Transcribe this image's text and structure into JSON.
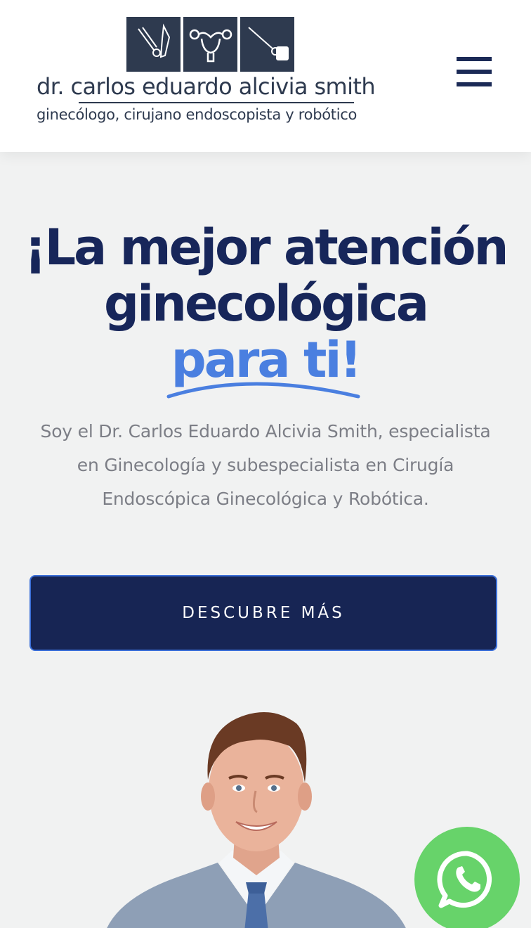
{
  "header": {
    "logo_name": "dr. carlos eduardo alcivia smith",
    "logo_subtitle": "ginecólogo, cirujano endoscopista y robótico",
    "menu_icon": "hamburger-menu-icon"
  },
  "hero": {
    "title_line1": "¡La mejor atención",
    "title_line2": "ginecológica",
    "title_accent": "para ti!",
    "description": "Soy el Dr. Carlos Eduardo Alcivia Smith, especialista en Ginecología y subespecialista en Cirugía Endoscópica Ginecológica y Robótica.",
    "cta_label": "DESCUBRE MÁS"
  },
  "floating": {
    "whatsapp_icon": "whatsapp-icon"
  },
  "colors": {
    "navy": "#17265a",
    "accent_blue": "#4a7fe0",
    "whatsapp_green": "#67d36a",
    "logo_slate": "#2e3a4f",
    "background": "#f1f2f2"
  }
}
